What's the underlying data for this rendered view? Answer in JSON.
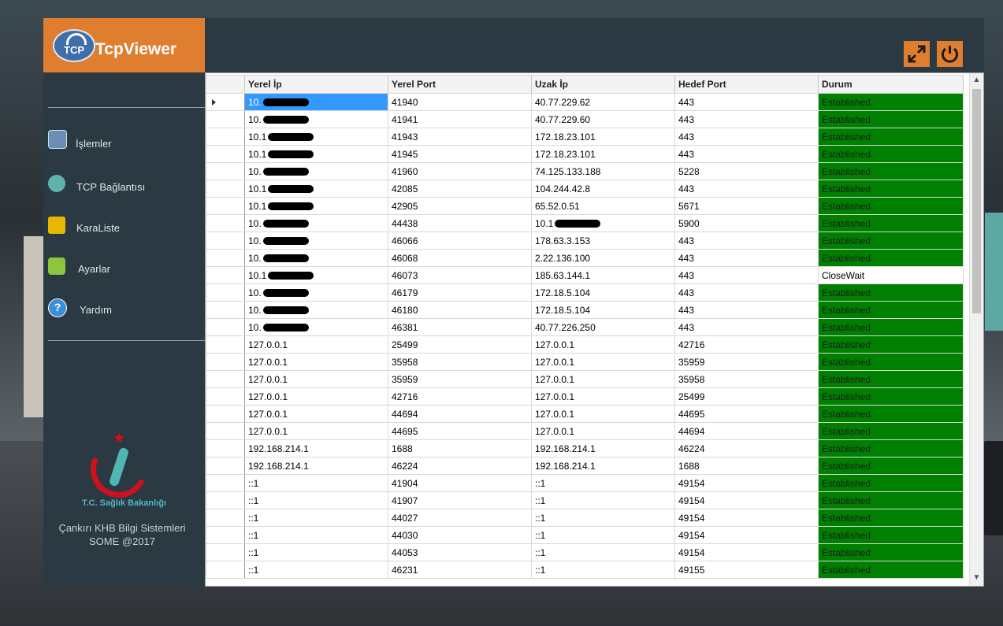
{
  "app": {
    "title": "TcpViewer",
    "logo_text": "TCP"
  },
  "sidebar": {
    "items": [
      {
        "label": "İşlemler",
        "icon": "process-icon"
      },
      {
        "label": "TCP Bağlantısı",
        "icon": "wifi-icon"
      },
      {
        "label": "KaraListe",
        "icon": "lock-icon"
      },
      {
        "label": "Ayarlar",
        "icon": "gear-icon"
      },
      {
        "label": "Yardım",
        "icon": "help-icon"
      }
    ],
    "ministry": "T.C. Sağlık Bakanlığı",
    "footer_line1": "Çankırı KHB Bilgi Sistemleri",
    "footer_line2": "SOME @2017"
  },
  "toolbar": {
    "expand_icon": "expand-icon",
    "power_icon": "power-icon"
  },
  "table": {
    "headers": [
      "Yerel İp",
      "Yerel Port",
      "Uzak İp",
      "Hedef Port",
      "Durum"
    ],
    "rows": [
      [
        "10.",
        "41940",
        "40.77.229.62",
        "443",
        "Established"
      ],
      [
        "10.",
        "41941",
        "40.77.229.60",
        "443",
        "Established"
      ],
      [
        "10.1",
        "41943",
        "172.18.23.101",
        "443",
        "Established"
      ],
      [
        "10.1",
        "41945",
        "172.18.23.101",
        "443",
        "Established"
      ],
      [
        "10.",
        "41960",
        "74.125.133.188",
        "5228",
        "Established"
      ],
      [
        "10.1",
        "42085",
        "104.244.42.8",
        "443",
        "Established"
      ],
      [
        "10.1",
        "42905",
        "65.52.0.51",
        "5671",
        "Established"
      ],
      [
        "10.",
        "44438",
        "10.1",
        "5900",
        "Established"
      ],
      [
        "10.",
        "46066",
        "178.63.3.153",
        "443",
        "Established"
      ],
      [
        "10.",
        "46068",
        "2.22.136.100",
        "443",
        "Established"
      ],
      [
        "10.1",
        "46073",
        "185.63.144.1",
        "443",
        "CloseWait"
      ],
      [
        "10.",
        "46179",
        "172.18.5.104",
        "443",
        "Established"
      ],
      [
        "10.",
        "46180",
        "172.18.5.104",
        "443",
        "Established"
      ],
      [
        "10.",
        "46381",
        "40.77.226.250",
        "443",
        "Established"
      ],
      [
        "127.0.0.1",
        "25499",
        "127.0.0.1",
        "42716",
        "Established"
      ],
      [
        "127.0.0.1",
        "35958",
        "127.0.0.1",
        "35959",
        "Established"
      ],
      [
        "127.0.0.1",
        "35959",
        "127.0.0.1",
        "35958",
        "Established"
      ],
      [
        "127.0.0.1",
        "42716",
        "127.0.0.1",
        "25499",
        "Established"
      ],
      [
        "127.0.0.1",
        "44694",
        "127.0.0.1",
        "44695",
        "Established"
      ],
      [
        "127.0.0.1",
        "44695",
        "127.0.0.1",
        "44694",
        "Established"
      ],
      [
        "192.168.214.1",
        "1688",
        "192.168.214.1",
        "46224",
        "Established"
      ],
      [
        "192.168.214.1",
        "46224",
        "192.168.214.1",
        "1688",
        "Established"
      ],
      [
        "::1",
        "41904",
        "::1",
        "49154",
        "Established"
      ],
      [
        "::1",
        "41907",
        "::1",
        "49154",
        "Established"
      ],
      [
        "::1",
        "44027",
        "::1",
        "49154",
        "Established"
      ],
      [
        "::1",
        "44030",
        "::1",
        "49154",
        "Established"
      ],
      [
        "::1",
        "44053",
        "::1",
        "49154",
        "Established"
      ],
      [
        "::1",
        "46231",
        "::1",
        "49155",
        "Established"
      ]
    ],
    "redacted_local": [
      true,
      true,
      true,
      true,
      true,
      true,
      true,
      true,
      true,
      true,
      true,
      true,
      true,
      true,
      false,
      false,
      false,
      false,
      false,
      false,
      false,
      false,
      false,
      false,
      false,
      false,
      false,
      false
    ],
    "redacted_remote": [
      false,
      false,
      false,
      false,
      false,
      false,
      false,
      true,
      false,
      false,
      false,
      false,
      false,
      false,
      false,
      false,
      false,
      false,
      false,
      false,
      false,
      false,
      false,
      false,
      false,
      false,
      false,
      false
    ],
    "selected_row": 0
  },
  "colors": {
    "accent": "#e07e2f",
    "sidebar": "#2b3942",
    "established": "#008000",
    "selection": "#3399ff"
  }
}
